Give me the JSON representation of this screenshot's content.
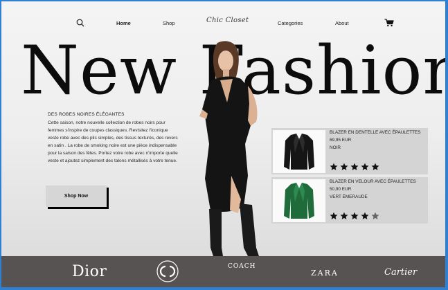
{
  "nav": {
    "items": [
      {
        "label": "Home",
        "active": true
      },
      {
        "label": "Shop",
        "active": false
      },
      {
        "label": "Categories",
        "active": false
      },
      {
        "label": "About",
        "active": false
      }
    ],
    "logo": "Chic Closet",
    "icons": {
      "search": "search-icon",
      "cart": "cart-icon"
    }
  },
  "hero": {
    "title": "New Fashion"
  },
  "description": {
    "heading": "DES ROBES NOIRES ÉLÉGANTES",
    "body": "Cette saison, notre nouvelle collection de robes noirs pour femmes s'inspire de coupes classiques. Revisitez l'iconique veste robe avec des plis simples, des tissus texturés, des revers en satin . La robe de smoking noire est une pièce indispensable pour la saison des fêtes. Portez votre robe avec n'importe quelle veste et ajoutez simplement des talons métallisés à votre tenue."
  },
  "cta": {
    "label": "Shop Now"
  },
  "products": [
    {
      "name": "BLAZER EN DENTELLE AVEC ÉPAULETTES",
      "price": "69,95 EUR",
      "color": "NOIR",
      "rating": 5,
      "swatch": "#111111"
    },
    {
      "name": "BLAZER EN VELOUR AVEC ÉPAULETTES",
      "price": "50,90 EUR",
      "color": "VERT ÉMERAUDE",
      "rating": 4,
      "swatch": "#1f6b3a"
    }
  ],
  "brands": {
    "dior": "Dior",
    "chanel": "chanel-logo",
    "coach": "COACH",
    "zara": "ZARA",
    "cartier": "Cartier"
  },
  "colors": {
    "background": "#eeeeee",
    "footer": "#575352",
    "card": "#d4d4d4",
    "border": "#2f7fd2"
  }
}
